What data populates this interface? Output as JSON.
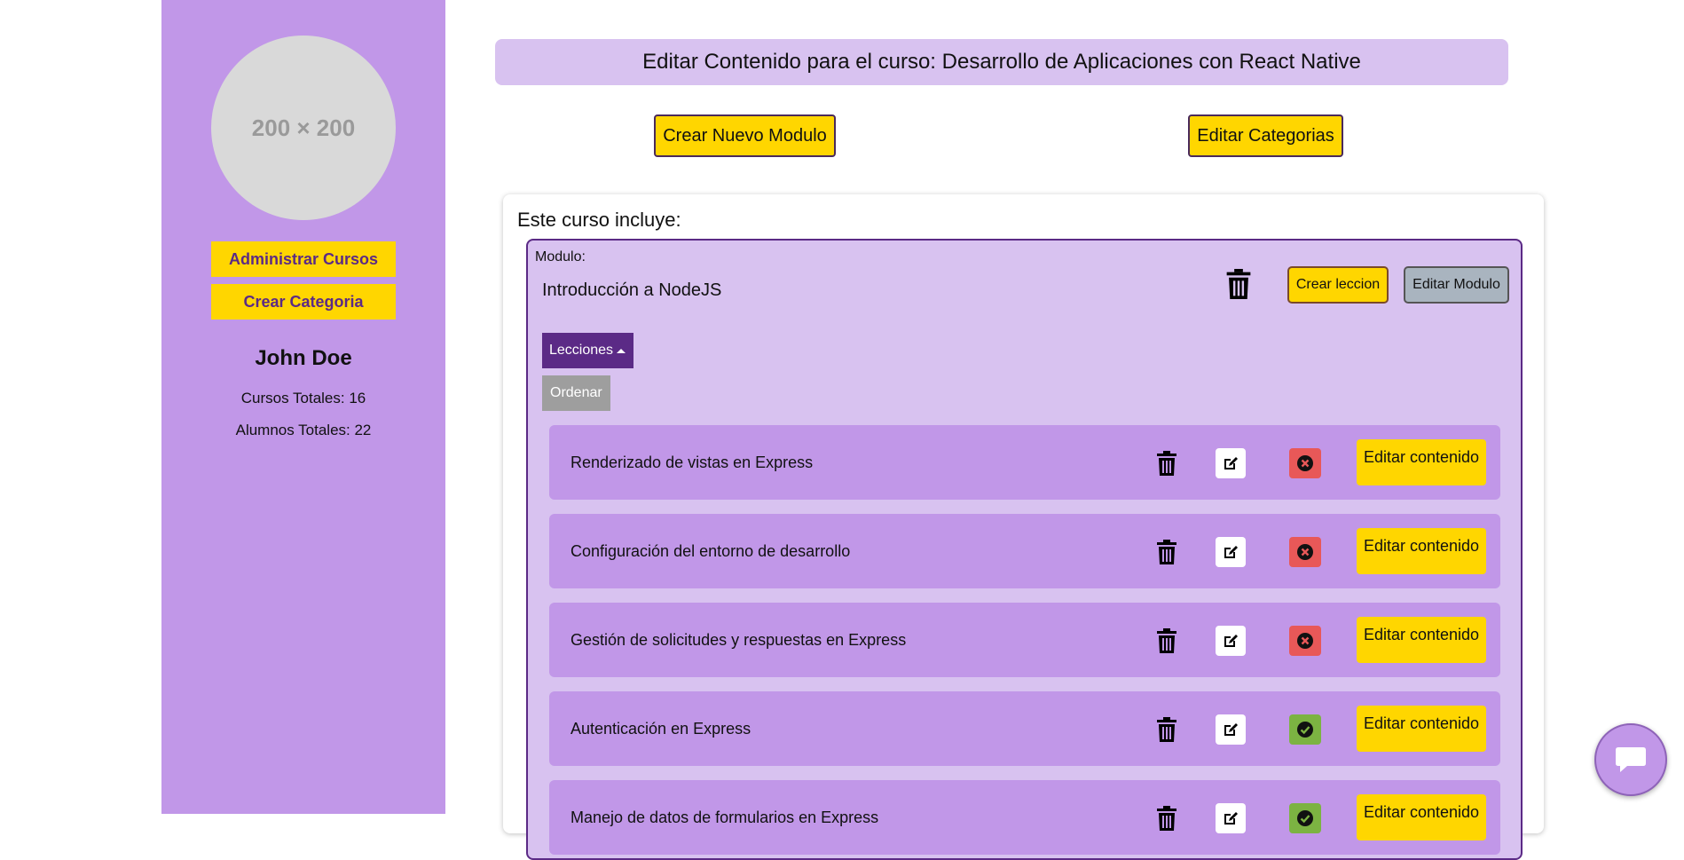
{
  "sidebar": {
    "avatar_placeholder": "200 × 200",
    "admin_courses_label": "Administrar Cursos",
    "create_category_label": "Crear Categoria",
    "user_name": "John Doe",
    "total_courses": "Cursos Totales: 16",
    "total_students": "Alumnos Totales: 22"
  },
  "header": {
    "title": "Editar Contenido para el curso: Desarrollo de Aplicaciones con React Native",
    "new_module_label": "Crear Nuevo Modulo",
    "edit_categories_label": "Editar Categorias"
  },
  "course": {
    "includes_heading": "Este curso incluye:",
    "module": {
      "label": "Modulo:",
      "name": "Introducción a NodeJS",
      "create_lesson_label": "Crear leccion",
      "edit_module_label": "Editar Modulo",
      "lessons_toggle_label": "Lecciones",
      "sort_label": "Ordenar",
      "lessons": [
        {
          "title": "Renderizado de vistas en Express",
          "status": "unpublished",
          "content_label": "Editar contenido"
        },
        {
          "title": "Configuración del entorno de desarrollo",
          "status": "unpublished",
          "content_label": "Editar contenido"
        },
        {
          "title": "Gestión de solicitudes y respuestas en Express",
          "status": "unpublished",
          "content_label": "Editar contenido"
        },
        {
          "title": "Autenticación en Express",
          "status": "published",
          "content_label": "Editar contenido"
        },
        {
          "title": "Manejo de datos de formularios en Express",
          "status": "published",
          "content_label": "Editar contenido"
        }
      ]
    }
  },
  "colors": {
    "sidebar_bg": "#c197e8",
    "light_purple": "#d8c2f0",
    "accent_yellow": "#ffd600",
    "dark_purple": "#5b2a86",
    "status_unpublished": "#e85858",
    "status_published": "#7cb342"
  },
  "icons": {
    "trash": "trash-icon",
    "edit": "edit-icon",
    "unpublished": "x-circle-icon",
    "published": "check-circle-icon",
    "chat": "chat-bubble-icon",
    "caret": "caret-up-icon"
  }
}
